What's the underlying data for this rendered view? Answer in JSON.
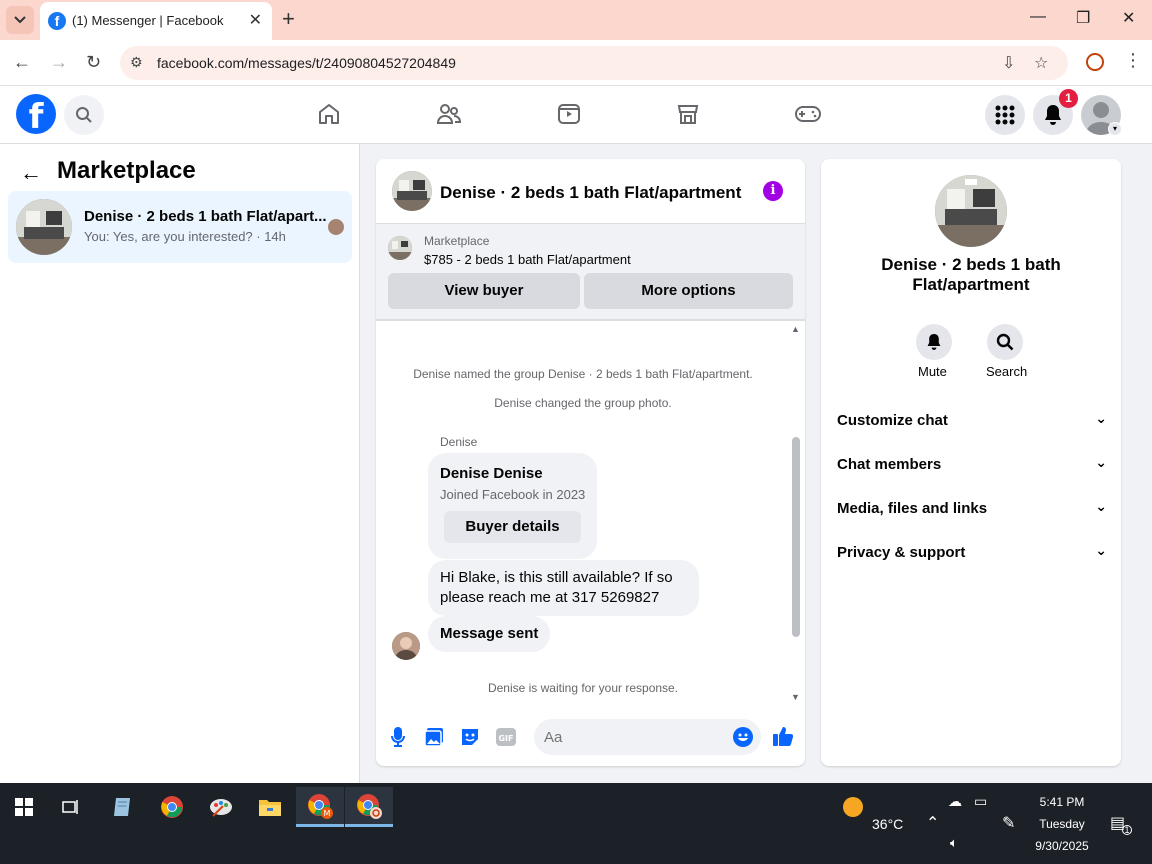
{
  "browser": {
    "tab_title": "(1) Messenger | Facebook",
    "url": "facebook.com/messages/t/24090804527204849"
  },
  "marketplace": {
    "title": "Marketplace",
    "conversation": {
      "name": "Denise · 2 beds 1 bath Flat/apart...",
      "snippet": "You: Yes, are you interested? · 14h"
    }
  },
  "notifications": {
    "count": "1"
  },
  "chat": {
    "name": "Denise · 2 beds 1 bath Flat/apartment",
    "listing": {
      "source": "Marketplace",
      "price_title": "$785 - 2 beds 1 bath Flat/apartment",
      "view_buyer": "View buyer",
      "more_options": "More options"
    },
    "messages": {
      "sys1": "Denise named the group Denise · 2 beds 1 bath Flat/apartment.",
      "sys2": "Denise changed the group photo.",
      "sender": "Denise",
      "card_name": "Denise Denise",
      "card_joined": "Joined Facebook in 2023",
      "card_button": "Buyer details",
      "msg1_line1": "Hi Blake, is this still available? If so",
      "msg1_line2": "please reach me at 317 5269827",
      "msg2": "Message sent",
      "waiting": "Denise is waiting for your response."
    },
    "composer": {
      "placeholder": "Aa",
      "gif": "GIF"
    }
  },
  "details": {
    "name_line1": "Denise · 2 beds 1 bath",
    "name_line2": "Flat/apartment",
    "mute": "Mute",
    "search": "Search",
    "sections": [
      "Customize chat",
      "Chat members",
      "Media, files and links",
      "Privacy & support"
    ]
  },
  "taskbar": {
    "temperature": "36°C",
    "time": "5:41 PM",
    "day": "Tuesday",
    "date": "9/30/2025",
    "notif_count": "1"
  },
  "colors": {
    "fb_blue": "#0866ff",
    "info_purple": "#a200e5",
    "badge_red": "#e41e3f",
    "selected_bg": "#ebf5ff"
  }
}
